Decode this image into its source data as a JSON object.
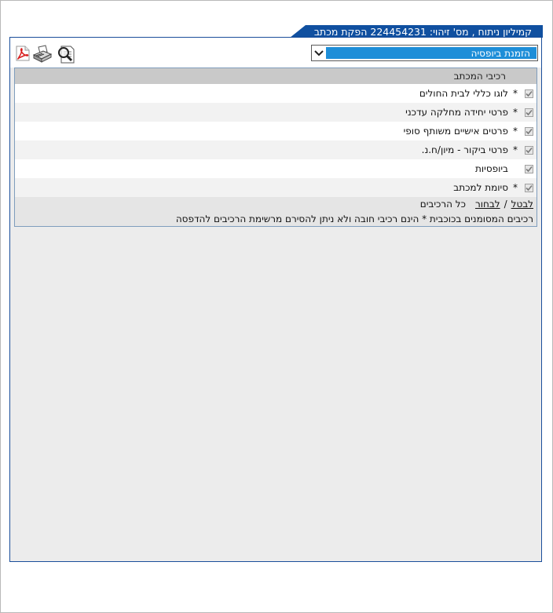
{
  "window": {
    "title": "קמיליון ניתוח , מס' זיהוי: 224454231 הפקת מכתב"
  },
  "toolbar": {
    "pdf_icon": "pdf-icon",
    "print_icon": "printer-icon",
    "preview_icon": "preview-magnifier-icon",
    "letter_type_select": {
      "selected": "הזמנת ביופסיה"
    }
  },
  "components": {
    "header": "רכיבי המכתב",
    "items": [
      {
        "label": "לוגו כללי לבית החולים",
        "mandatory": "*",
        "checked": true
      },
      {
        "label": "פרטי יחידה מחלקה עדכני",
        "mandatory": "*",
        "checked": true
      },
      {
        "label": "פרטים אישיים משותף סופי",
        "mandatory": "*",
        "checked": true
      },
      {
        "label": "פרטי ביקור - מיון/ח.נ.",
        "mandatory": "*",
        "checked": true
      },
      {
        "label": "ביופסיות",
        "mandatory": "",
        "checked": true
      },
      {
        "label": "סיומת למכתב",
        "mandatory": "*",
        "checked": true
      }
    ],
    "cancel_link": "לבטל",
    "separator": "/",
    "select_link": "לבחור",
    "all_components": "כל הרכיבים",
    "note": "רכיבים המסומנים בכוכבית * הינם רכיבי חובה ולא ניתן להסירם מרשימת הרכיבים להדפסה"
  },
  "colors": {
    "title_bar": "#1050a0",
    "select_highlight": "#1e8ed8",
    "panel_border": "#1a4e9a"
  }
}
